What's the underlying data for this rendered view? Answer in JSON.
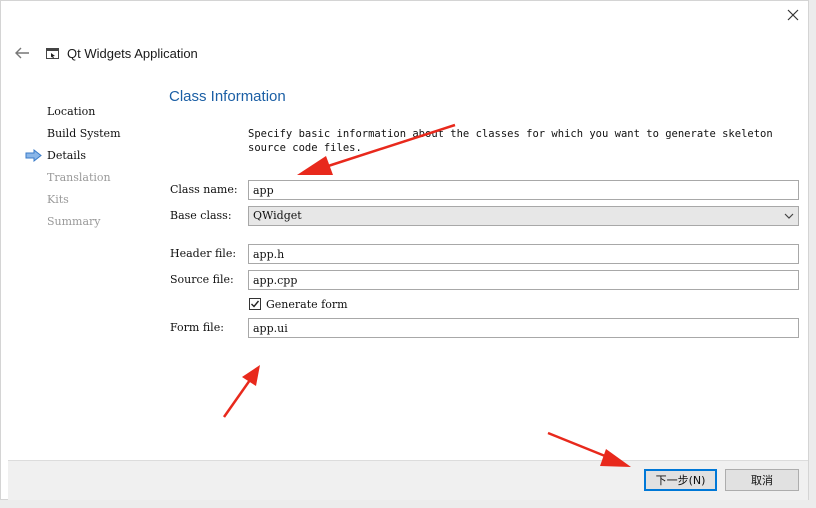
{
  "window": {
    "title": "Qt Widgets Application",
    "close_icon": "close-icon",
    "back_icon": "back-arrow-icon",
    "app_icon": "qt-widgets-app-icon"
  },
  "wizard_steps": [
    {
      "label": "Location",
      "state": "done"
    },
    {
      "label": "Build System",
      "state": "done"
    },
    {
      "label": "Details",
      "state": "current"
    },
    {
      "label": "Translation",
      "state": "pending"
    },
    {
      "label": "Kits",
      "state": "pending"
    },
    {
      "label": "Summary",
      "state": "pending"
    }
  ],
  "page": {
    "title": "Class Information",
    "description": "Specify basic information about the classes for which you want to generate skeleton source code files."
  },
  "form": {
    "class_name_label": "Class name:",
    "class_name_value": "app",
    "base_class_label": "Base class:",
    "base_class_value": "QWidget",
    "header_file_label": "Header file:",
    "header_file_value": "app.h",
    "source_file_label": "Source file:",
    "source_file_value": "app.cpp",
    "generate_form_label": "Generate form",
    "generate_form_checked": true,
    "form_file_label": "Form file:",
    "form_file_value": "app.ui"
  },
  "buttons": {
    "next_label": "下一步(N)",
    "cancel_label": "取消"
  },
  "colors": {
    "accent": "#0078d7",
    "title_blue": "#1b5fa5",
    "annotation_red": "#e8291c",
    "step_arrow_blue": "#4a90d9"
  }
}
